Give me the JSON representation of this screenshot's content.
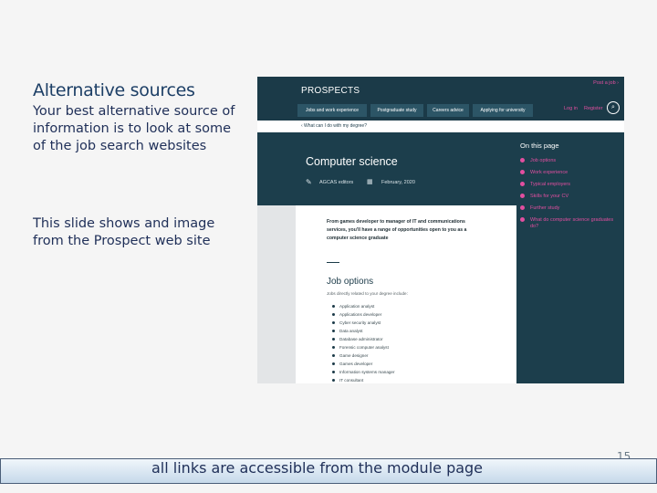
{
  "slide": {
    "title": "Alternative sources",
    "paragraph1": "Your best alternative source of information is to look at some of the job search websites",
    "paragraph2": "This slide shows and image from the Prospect web site",
    "footer": "all links are accessible from the module page",
    "slide_number": "15"
  },
  "screenshot": {
    "brand": "PROSPECTS",
    "post_job": "Post a job ›",
    "nav_tabs": [
      "Jobs and work experience",
      "Postgraduate study",
      "Careers advice",
      "Applying for university"
    ],
    "login": "Log in",
    "register": "Register",
    "breadcrumb": "‹  What can I do with my degree?",
    "page_title": "Computer science",
    "author": "AGCAS editors",
    "date": "February, 2020",
    "intro": "From games developer to manager of IT and communications services, you'll have a range of opportunities open to you as a computer science graduate",
    "job_options_heading": "Job options",
    "jobs_intro": "Jobs directly related to your degree include:",
    "jobs": [
      "Application analyst",
      "Applications developer",
      "Cyber security analyst",
      "Data analyst",
      "Database administrator",
      "Forensic computer analyst",
      "Game designer",
      "Games developer",
      "Information systems manager",
      "IT consultant"
    ],
    "on_this_page_heading": "On this page",
    "on_this_page": [
      "Job options",
      "Work experience",
      "Typical employers",
      "Skills for your CV",
      "Further study",
      "What do computer science graduates do?"
    ],
    "colors": {
      "header": "#1b3a48",
      "accent": "#e24fa0"
    }
  }
}
